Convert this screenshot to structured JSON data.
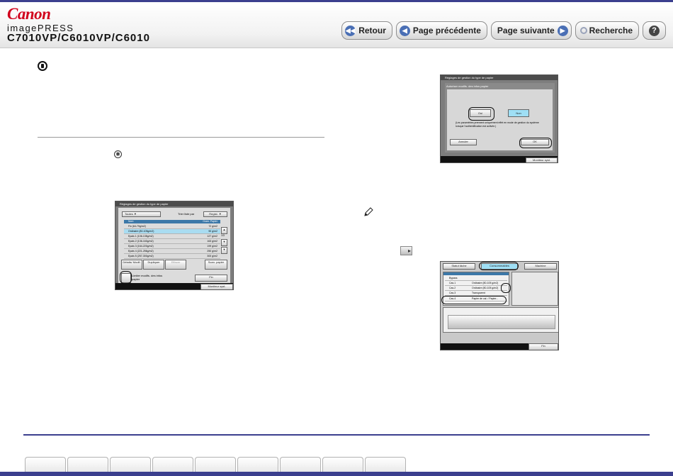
{
  "header": {
    "logo": "Canon",
    "product": "imagePRESS",
    "models": "C7010VP/C6010VP/C6010"
  },
  "nav": {
    "back": "Retour",
    "prev": "Page précédente",
    "next": "Page suivante",
    "search": "Recherche",
    "help": "?"
  },
  "shot1": {
    "title": "Réglages de gestion du type de papier",
    "filter": "Toutes",
    "sort_label": "Trier liste par",
    "sort_value": "Regist.",
    "col_name": "Nom",
    "col_grammage": "Gram. Papier",
    "rows": [
      {
        "name": "Fin (64-79g/m2)",
        "g": "72 g/m2"
      },
      {
        "name": "Ordinaire (80-105g/m2)",
        "g": "90 g/m2"
      },
      {
        "name": "Epais 1 (106-135g/m2)",
        "g": "127 g/m2"
      },
      {
        "name": "Epais 2 (136-163g/m2)",
        "g": "163 g/m2"
      },
      {
        "name": "Epais 3 (164-220g/m2)",
        "g": "199 g/m2"
      },
      {
        "name": "Epais 4 (221-256g/m2)",
        "g": "250 g/m2"
      },
      {
        "name": "Epais 5 (257-300g/m2)",
        "g": "300 g/m2"
      }
    ],
    "page": "1/3",
    "btn_details": "Détails/ Modif.",
    "btn_duplicate": "Dupliquer",
    "btn_delete": "Effacer",
    "btn_scan": "Scan. papier",
    "restrict": "Limiter modifs. des infos papier",
    "done": "Fin",
    "status": "Moniteur syst."
  },
  "shot2": {
    "title": "Réglages de gestion du type de papier",
    "subtitle": "Autoriser modifs. des infos papier",
    "yes": "Oui",
    "no": "Non",
    "note": "(Les paramètres prennent uniquement effet en mode de gestion du système lorsque l'authentification est activée.)",
    "cancel": "Annuler",
    "ok": "OK",
    "status": "Moniteur syst."
  },
  "shot3": {
    "tab_status": "Statut tâche",
    "tab_consumables": "Consommables",
    "tab_device": "Machine",
    "sources": [
      {
        "slot": "Bypass",
        "type": ""
      },
      {
        "slot": "Cas.1",
        "type": "Ordinaire (80-105 g/m2)"
      },
      {
        "slot": "Cas.2",
        "type": "Ordinaire (80-105 g/m2)"
      },
      {
        "slot": "Cas.3",
        "type": "Transparent"
      },
      {
        "slot": "Cas.4",
        "type": "Papier de cal. / Papier..."
      }
    ],
    "done": "Fin",
    "status": "Moniteur syst."
  },
  "colors": {
    "brand_red": "#d1001c",
    "nav_blue": "#3b3f8e",
    "selection": "#a9dcf1"
  }
}
